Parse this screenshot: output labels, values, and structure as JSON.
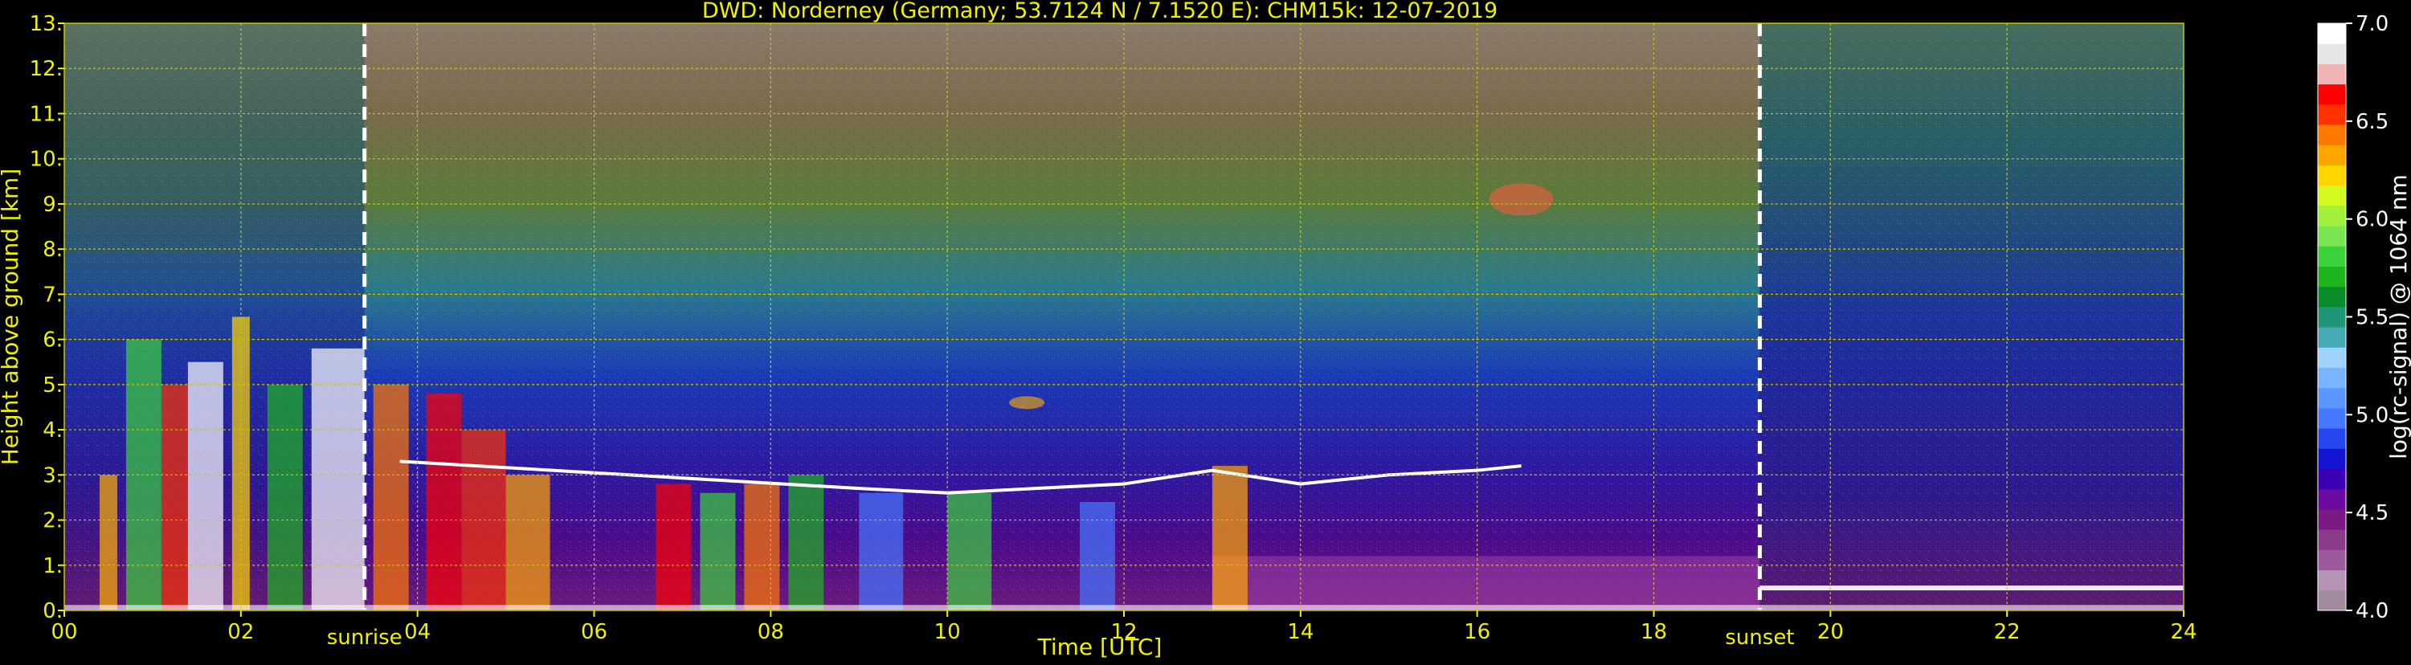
{
  "chart_data": {
    "type": "heatmap",
    "title": "DWD: Norderney (Germany; 53.7124 N / 7.1520 E):    CHM15k: 12-07-2019",
    "xlabel": "Time [UTC]",
    "ylabel": "Height above ground [km]",
    "xlim": [
      0,
      24
    ],
    "ylim": [
      0,
      13
    ],
    "x_ticks": [
      "00",
      "02",
      "04",
      "06",
      "08",
      "10",
      "12",
      "14",
      "16",
      "18",
      "20",
      "22",
      "24"
    ],
    "y_ticks": [
      "0.",
      "1.",
      "2.",
      "3.",
      "4.",
      "5.",
      "6.",
      "7.",
      "8.",
      "9.",
      "10.",
      "11.",
      "12.",
      "13."
    ],
    "grid": true,
    "colorbar": {
      "label": "log(rc-signal) @ 1064 nm",
      "range": [
        4.0,
        7.0
      ],
      "ticks": [
        "4.0",
        "4.5",
        "5.0",
        "5.5",
        "6.0",
        "6.5",
        "7.0"
      ],
      "colors": [
        "#a08aa0",
        "#b494b4",
        "#9c5a9c",
        "#8a3c8a",
        "#7a1a82",
        "#6a0aa0",
        "#3c00b4",
        "#1414d2",
        "#2846f0",
        "#4678ff",
        "#5a96ff",
        "#78b4ff",
        "#a0d2ff",
        "#46aab4",
        "#1e9678",
        "#0a8c28",
        "#1eb41e",
        "#3cd23c",
        "#78e650",
        "#a0f03c",
        "#d2fa1e",
        "#ffd700",
        "#ffa500",
        "#ff7800",
        "#ff3200",
        "#ff0000",
        "#f0b4b4",
        "#e6e6e6",
        "#ffffff"
      ]
    },
    "annotations": [
      {
        "label": "sunrise",
        "x": 3.4
      },
      {
        "label": "sunset",
        "x": 19.2
      }
    ],
    "cloud_base_km": [
      [
        3.8,
        3.3
      ],
      [
        9.0,
        2.7
      ],
      [
        10.0,
        2.6
      ],
      [
        11.0,
        2.7
      ],
      [
        12.0,
        2.8
      ],
      [
        13.0,
        3.1
      ],
      [
        14.0,
        2.8
      ],
      [
        15.0,
        3.0
      ],
      [
        16.0,
        3.1
      ],
      [
        16.5,
        3.2
      ]
    ],
    "colors": {
      "axes_text": "#f0f000",
      "grid": "#c8c800",
      "background": "#000000",
      "colorbar_text": "#ffffff"
    }
  }
}
